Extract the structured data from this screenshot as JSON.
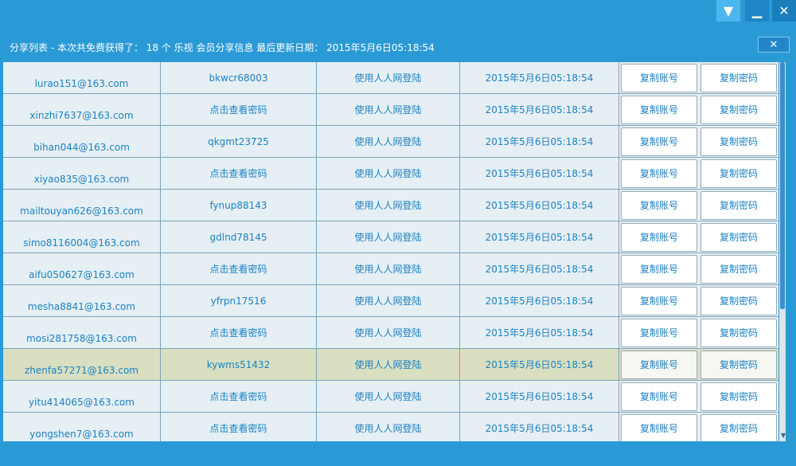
{
  "window": {
    "dropdown_icon": "▼",
    "minimize_icon": "▁",
    "close_icon": "✕"
  },
  "header": {
    "text": "分享列表 - 本次共免费获得了： 18 个 乐视 会员分享信息 最后更新日期： 2015年5月6日05:18:54"
  },
  "panel": {
    "close_icon": "✕"
  },
  "rows": [
    {
      "account": "lurao151@163.com",
      "password": "bkwcr68003",
      "login": "使用人人网登陆",
      "date": "2015年5月6日05:18:54",
      "copy_account": "复制账号",
      "copy_password": "复制密码"
    },
    {
      "account": "xinzhi7637@163.com",
      "password": "点击查看密码",
      "login": "使用人人网登陆",
      "date": "2015年5月6日05:18:54",
      "copy_account": "复制账号",
      "copy_password": "复制密码"
    },
    {
      "account": "bihan044@163.com",
      "password": "qkgmt23725",
      "login": "使用人人网登陆",
      "date": "2015年5月6日05:18:54",
      "copy_account": "复制账号",
      "copy_password": "复制密码"
    },
    {
      "account": "xiyao835@163.com",
      "password": "点击查看密码",
      "login": "使用人人网登陆",
      "date": "2015年5月6日05:18:54",
      "copy_account": "复制账号",
      "copy_password": "复制密码"
    },
    {
      "account": "mailtouyan626@163.com",
      "password": "fynup88143",
      "login": "使用人人网登陆",
      "date": "2015年5月6日05:18:54",
      "copy_account": "复制账号",
      "copy_password": "复制密码"
    },
    {
      "account": "simo8116004@163.com",
      "password": "gdlnd78145",
      "login": "使用人人网登陆",
      "date": "2015年5月6日05:18:54",
      "copy_account": "复制账号",
      "copy_password": "复制密码"
    },
    {
      "account": "aifu050627@163.com",
      "password": "点击查看密码",
      "login": "使用人人网登陆",
      "date": "2015年5月6日05:18:54",
      "copy_account": "复制账号",
      "copy_password": "复制密码"
    },
    {
      "account": "mesha8841@163.com",
      "password": "yfrpn17516",
      "login": "使用人人网登陆",
      "date": "2015年5月6日05:18:54",
      "copy_account": "复制账号",
      "copy_password": "复制密码"
    },
    {
      "account": "mosi281758@163.com",
      "password": "点击查看密码",
      "login": "使用人人网登陆",
      "date": "2015年5月6日05:18:54",
      "copy_account": "复制账号",
      "copy_password": "复制密码"
    },
    {
      "account": "zhenfa57271@163.com",
      "password": "kywms51432",
      "login": "使用人人网登陆",
      "date": "2015年5月6日05:18:54",
      "copy_account": "复制账号",
      "copy_password": "复制密码",
      "selected": true
    },
    {
      "account": "yitu414065@163.com",
      "password": "点击查看密码",
      "login": "使用人人网登陆",
      "date": "2015年5月6日05:18:54",
      "copy_account": "复制账号",
      "copy_password": "复制密码"
    },
    {
      "account": "yongshen7@163.com",
      "password": "点击查看密码",
      "login": "使用人人网登陆",
      "date": "2015年5月6日05:18:54",
      "copy_account": "复制账号",
      "copy_password": "复制密码"
    }
  ],
  "colors": {
    "background": "#2a9ad6",
    "text_link": "#1b82c6",
    "row_selected": "#d9dfc0"
  }
}
